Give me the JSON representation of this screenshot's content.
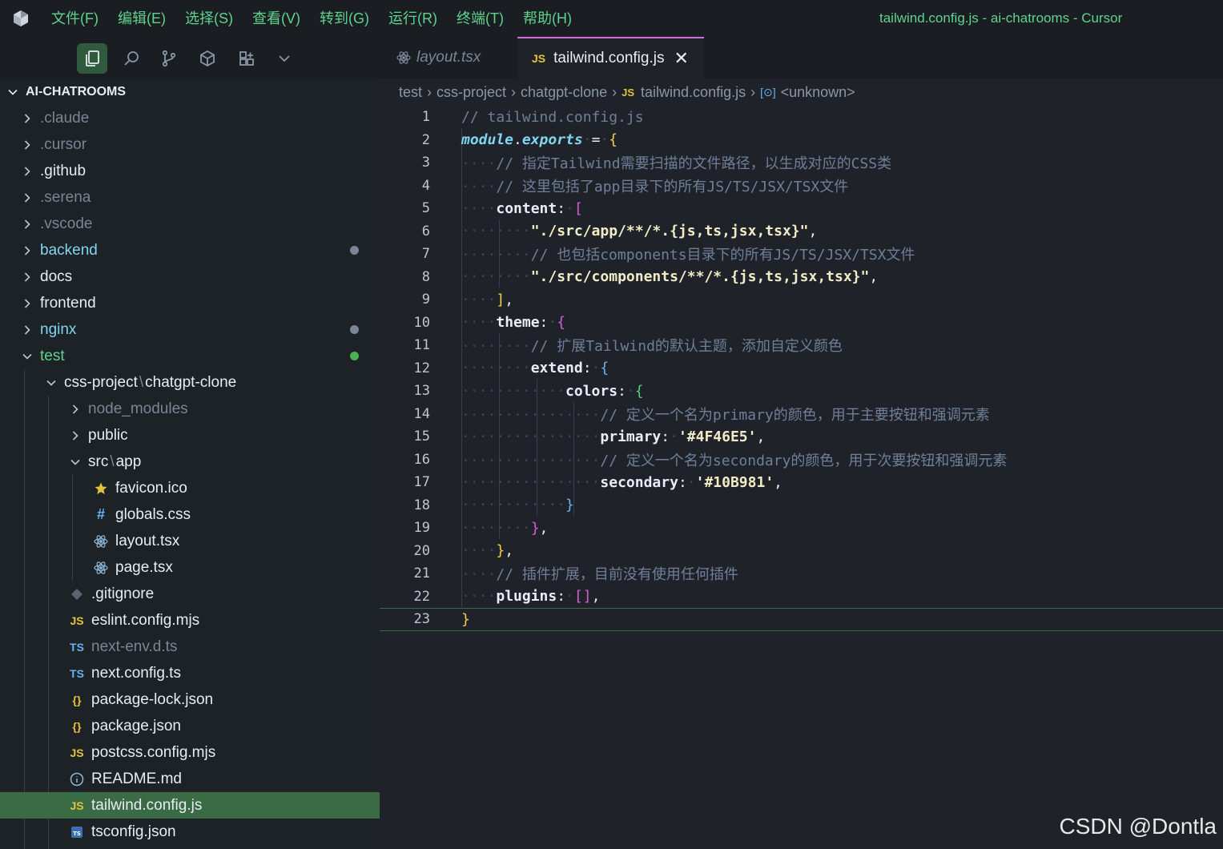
{
  "menu": [
    "文件(F)",
    "编辑(E)",
    "选择(S)",
    "查看(V)",
    "转到(G)",
    "运行(R)",
    "终端(T)",
    "帮助(H)"
  ],
  "window_title": "tailwind.config.js - ai-chatrooms - Cursor",
  "toolbar_icons": [
    "explorer-icon",
    "search-icon",
    "source-control-icon",
    "extensions-icon",
    "layout-icon",
    "chevron-down-icon"
  ],
  "tabs": [
    {
      "label": "layout.tsx",
      "icon": "react-icon",
      "active": false
    },
    {
      "label": "tailwind.config.js",
      "icon_text": "JS",
      "active": true
    }
  ],
  "explorer": {
    "title": "AI-CHATROOMS",
    "items": [
      {
        "label": ".claude",
        "kind": "folder",
        "open": false,
        "depth": 0,
        "color": "#7a8696"
      },
      {
        "label": ".cursor",
        "kind": "folder",
        "open": false,
        "depth": 0,
        "color": "#7a8696"
      },
      {
        "label": ".github",
        "kind": "folder",
        "open": false,
        "depth": 0,
        "color": "#e6edf3"
      },
      {
        "label": ".serena",
        "kind": "folder",
        "open": false,
        "depth": 0,
        "color": "#7a8696"
      },
      {
        "label": ".vscode",
        "kind": "folder",
        "open": false,
        "depth": 0,
        "color": "#7a8696"
      },
      {
        "label": "backend",
        "kind": "folder",
        "open": false,
        "depth": 0,
        "color": "#7fd6ef",
        "dot": "#7a8696"
      },
      {
        "label": "docs",
        "kind": "folder",
        "open": false,
        "depth": 0,
        "color": "#e6edf3"
      },
      {
        "label": "frontend",
        "kind": "folder",
        "open": false,
        "depth": 0,
        "color": "#e6edf3"
      },
      {
        "label": "nginx",
        "kind": "folder",
        "open": false,
        "depth": 0,
        "color": "#7fd6ef",
        "dot": "#7a8696"
      },
      {
        "label": "test",
        "kind": "folder",
        "open": true,
        "depth": 0,
        "color": "#5fd38d",
        "dot": "#4caf50"
      },
      {
        "label": "css-project",
        "label2": "chatgpt-clone",
        "kind": "folder",
        "open": true,
        "depth": 1,
        "color": "#e6edf3"
      },
      {
        "label": "node_modules",
        "kind": "folder",
        "open": false,
        "depth": 2,
        "color": "#7a8696"
      },
      {
        "label": "public",
        "kind": "folder",
        "open": false,
        "depth": 2,
        "color": "#e6edf3"
      },
      {
        "label": "src",
        "label2": "app",
        "kind": "folder",
        "open": true,
        "depth": 2,
        "color": "#e6edf3"
      },
      {
        "label": "favicon.ico",
        "kind": "file",
        "icon": "star-icon",
        "depth": 3,
        "color": "#e6edf3"
      },
      {
        "label": "globals.css",
        "kind": "file",
        "icon": "hash-icon",
        "depth": 3,
        "color": "#e6edf3"
      },
      {
        "label": "layout.tsx",
        "kind": "file",
        "icon": "react-icon",
        "depth": 3,
        "color": "#e6edf3"
      },
      {
        "label": "page.tsx",
        "kind": "file",
        "icon": "react-icon",
        "depth": 3,
        "color": "#e6edf3"
      },
      {
        "label": ".gitignore",
        "kind": "file",
        "icon": "git-icon",
        "depth": 2,
        "color": "#e6edf3"
      },
      {
        "label": "eslint.config.mjs",
        "kind": "file",
        "icon_text": "JS",
        "depth": 2,
        "color": "#e6edf3"
      },
      {
        "label": "next-env.d.ts",
        "kind": "file",
        "icon_text": "TS",
        "depth": 2,
        "color": "#7a8696"
      },
      {
        "label": "next.config.ts",
        "kind": "file",
        "icon_text": "TS",
        "depth": 2,
        "color": "#e6edf3"
      },
      {
        "label": "package-lock.json",
        "kind": "file",
        "icon_text": "{}",
        "depth": 2,
        "color": "#e6edf3"
      },
      {
        "label": "package.json",
        "kind": "file",
        "icon_text": "{}",
        "depth": 2,
        "color": "#e6edf3"
      },
      {
        "label": "postcss.config.mjs",
        "kind": "file",
        "icon_text": "JS",
        "depth": 2,
        "color": "#e6edf3"
      },
      {
        "label": "README.md",
        "kind": "file",
        "icon": "info-icon",
        "depth": 2,
        "color": "#e6edf3"
      },
      {
        "label": "tailwind.config.js",
        "kind": "file",
        "icon_text": "JS",
        "depth": 2,
        "color": "#e6edf3",
        "selected": true
      },
      {
        "label": "tsconfig.json",
        "kind": "file",
        "icon": "tsconfig-icon",
        "depth": 2,
        "color": "#e6edf3"
      }
    ]
  },
  "breadcrumb": [
    "test",
    "css-project",
    "chatgpt-clone",
    "tailwind.config.js",
    "<unknown>"
  ],
  "code_lines": [
    "// tailwind.config.js",
    "module.exports = {",
    "    // 指定Tailwind需要扫描的文件路径，以生成对应的CSS类",
    "    // 这里包括了app目录下的所有JS/TS/JSX/TSX文件",
    "    content: [",
    "        \"./src/app/**/*.{js,ts,jsx,tsx}\",",
    "        // 也包括components目录下的所有JS/TS/JSX/TSX文件",
    "        \"./src/components/**/*.{js,ts,jsx,tsx}\",",
    "    ],",
    "    theme: {",
    "        // 扩展Tailwind的默认主题，添加自定义颜色",
    "        extend: {",
    "            colors: {",
    "                // 定义一个名为primary的颜色，用于主要按钮和强调元素",
    "                primary: '#4F46E5',",
    "                // 定义一个名为secondary的颜色，用于次要按钮和强调元素",
    "                secondary: '#10B981',",
    "            }",
    "        },",
    "    },",
    "    // 插件扩展，目前没有使用任何插件",
    "    plugins: [],",
    "}"
  ],
  "current_line": 23,
  "watermark": "CSDN @Dontla",
  "colors": {
    "accent_green": "#5fd38d",
    "selected_row": "#3a6b45",
    "tab_accent": "#cf6fd8"
  }
}
